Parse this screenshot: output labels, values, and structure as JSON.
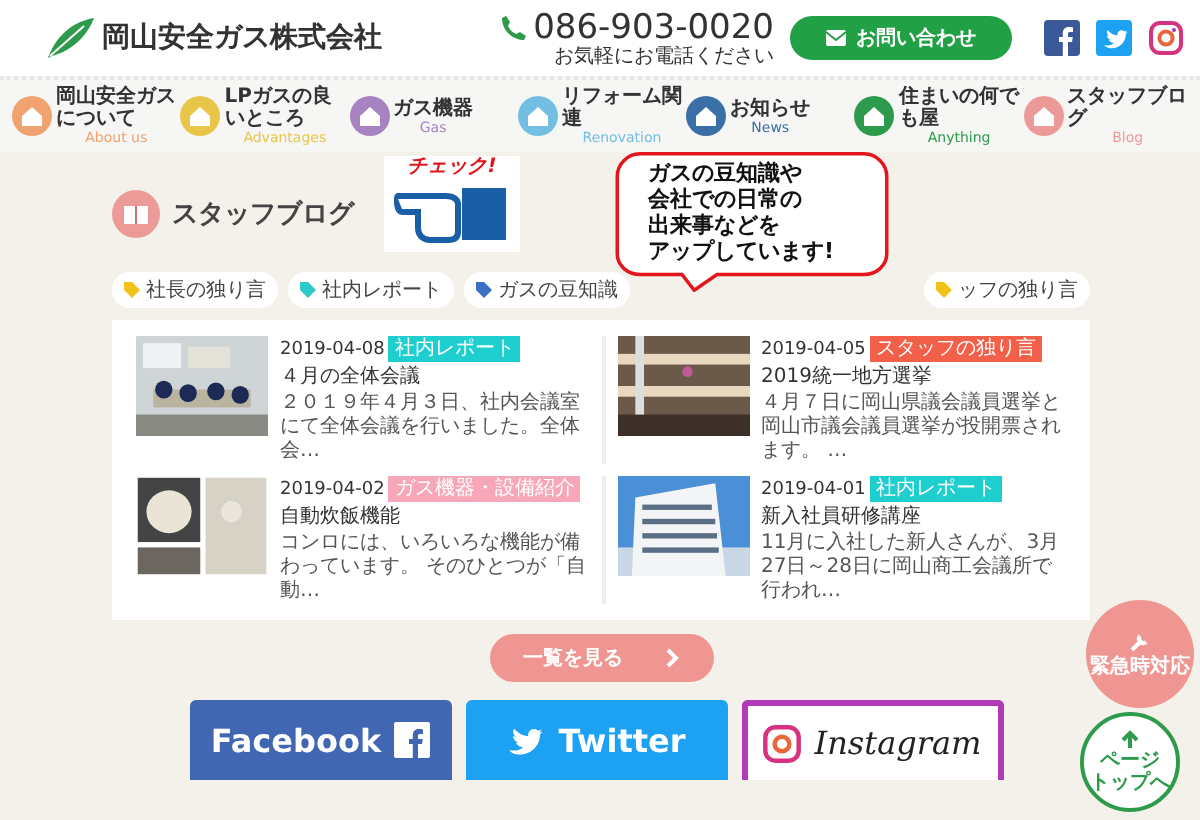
{
  "header": {
    "company": "岡山安全ガス株式会社",
    "phone": "086-903-0020",
    "phone_note": "お気軽にお電話ください",
    "contact_button": "お問い合わせ"
  },
  "nav": [
    {
      "label": "岡山安全ガスについて",
      "sub": "About us",
      "color": "#f0a36e"
    },
    {
      "label": "LPガスの良いところ",
      "sub": "Advantages",
      "color": "#e8c64a"
    },
    {
      "label": "ガス機器",
      "sub": "Gas",
      "color": "#a783c2"
    },
    {
      "label": "リフォーム関連",
      "sub": "Renovation",
      "color": "#72bfe3"
    },
    {
      "label": "お知らせ",
      "sub": "News",
      "color": "#3a6fa8"
    },
    {
      "label": "住まいの何でも屋",
      "sub": "Anything",
      "color": "#2e9a4c"
    },
    {
      "label": "スタッフブログ",
      "sub": "Blog",
      "color": "#ec9a98"
    }
  ],
  "blog": {
    "title": "スタッフブログ",
    "check_label": "チェック!",
    "bubble_lines": [
      "ガスの豆知識や",
      "会社での日常の",
      "出来事などを",
      "アップしています!"
    ],
    "tags": [
      {
        "label": "社長の独り言",
        "color": "#f2c21b"
      },
      {
        "label": "社内レポート",
        "color": "#2ec9c9"
      },
      {
        "label": "ガスの豆知識",
        "color": "#3a6fc4"
      },
      {
        "label": "ッフの独り言",
        "color": "#f2c21b"
      }
    ],
    "posts": [
      {
        "date": "2019-04-08",
        "category": "社内レポート",
        "color": "#1fcfcf",
        "title": "４月の全体会議",
        "excerpt": "２０１９年４月３日、社内会議室にて全体会議を行いました。全体会…"
      },
      {
        "date": "2019-04-05",
        "category": "スタッフの独り言",
        "color": "#f2604a",
        "title": "2019統一地方選挙",
        "excerpt": "４月７日に岡山県議会議員選挙と岡山市議会議員選挙が投開票されます。 …"
      },
      {
        "date": "2019-04-02",
        "category": "ガス機器・設備紹介",
        "color": "#f7a7b8",
        "title": "自動炊飯機能",
        "excerpt": "コンロには、いろいろな機能が備わっています。 そのひとつが「自動…"
      },
      {
        "date": "2019-04-01",
        "category": "社内レポート",
        "color": "#1fcfcf",
        "title": "新入社員研修講座",
        "excerpt": "11月に入社した新人さんが、3月27日～28日に岡山商工会議所で行われ…"
      }
    ],
    "more_button": "一覧を見る"
  },
  "social": [
    {
      "kind": "facebook",
      "label": "Facebook"
    },
    {
      "kind": "twitter",
      "label": "Twitter"
    },
    {
      "kind": "instagram",
      "label": "Instagram"
    }
  ],
  "floating": {
    "emergency": "緊急時対応",
    "page_top_lines": [
      "ページ",
      "トップへ"
    ]
  }
}
